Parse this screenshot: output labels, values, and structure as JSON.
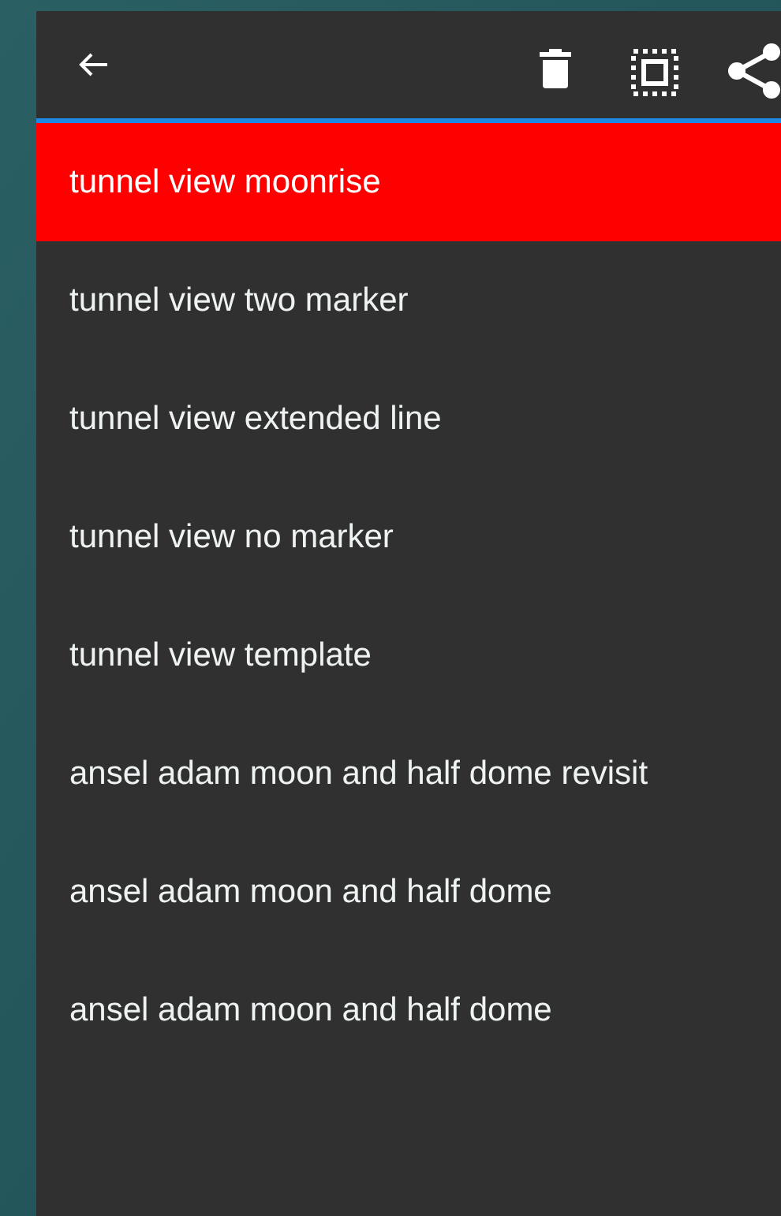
{
  "items": [
    {
      "label": "tunnel view moonrise",
      "selected": true
    },
    {
      "label": "tunnel view two marker",
      "selected": false
    },
    {
      "label": "tunnel view extended line",
      "selected": false
    },
    {
      "label": "tunnel view no marker",
      "selected": false
    },
    {
      "label": "tunnel view template",
      "selected": false
    },
    {
      "label": "ansel adam moon and half dome revisit",
      "selected": false
    },
    {
      "label": "ansel adam moon and half dome",
      "selected": false
    },
    {
      "label": "ansel adam moon and half dome",
      "selected": false
    }
  ]
}
